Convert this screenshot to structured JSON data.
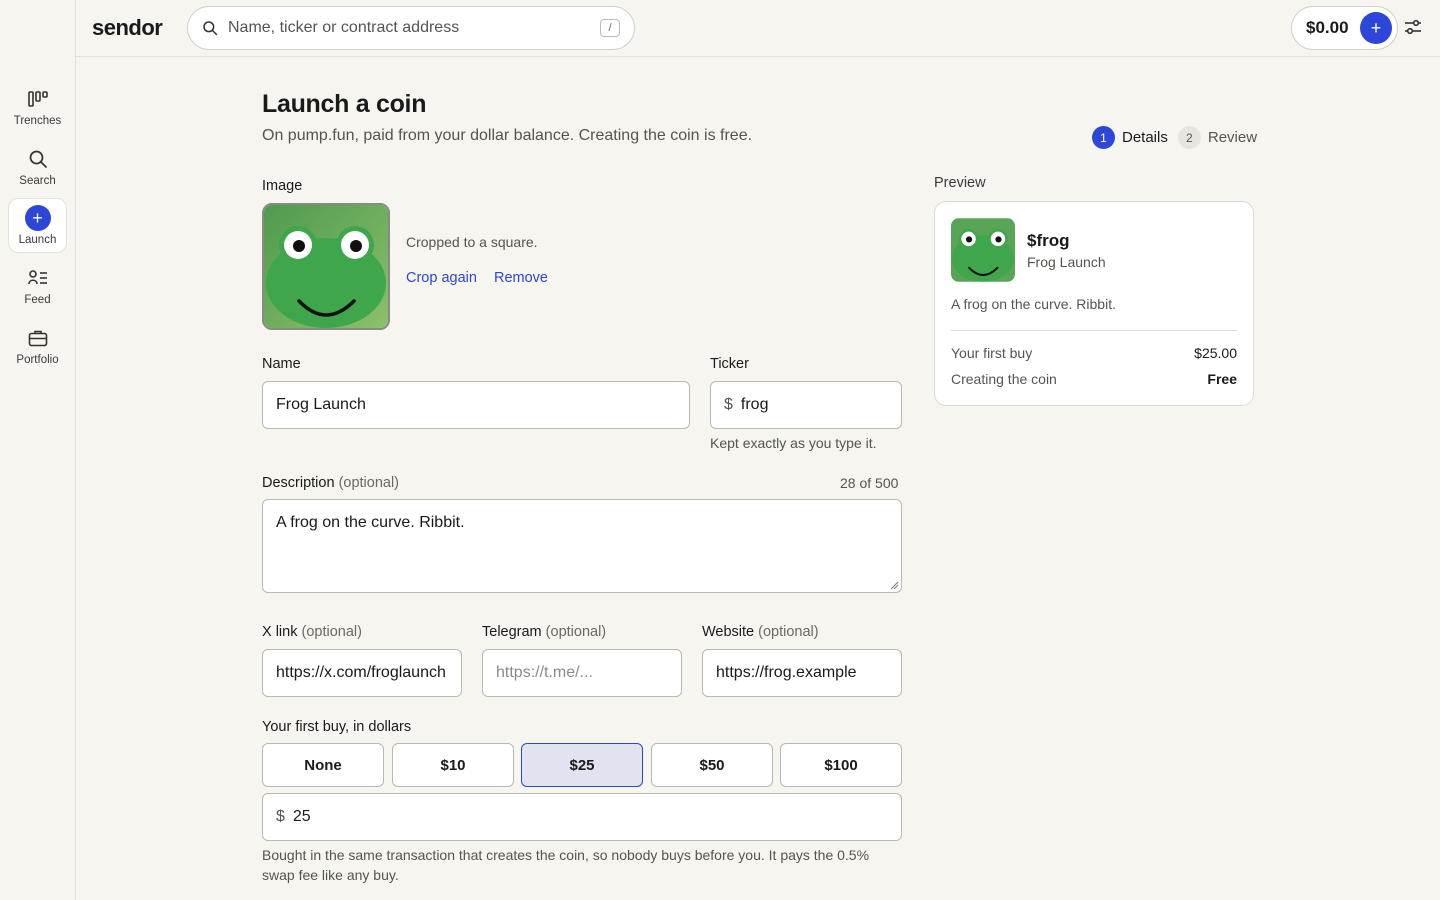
{
  "app": {
    "logo": "sendor"
  },
  "search": {
    "placeholder": "Name, ticker or contract address",
    "shortcut": "/"
  },
  "header": {
    "balance": "$0.00",
    "add_label": "+"
  },
  "sidebar": {
    "items": [
      {
        "label": "Trenches",
        "icon": "trenches-icon"
      },
      {
        "label": "Search",
        "icon": "search-icon"
      },
      {
        "label": "Launch",
        "icon": "plus-icon"
      },
      {
        "label": "Feed",
        "icon": "feed-icon"
      },
      {
        "label": "Portfolio",
        "icon": "briefcase-icon"
      }
    ],
    "active": "Launch"
  },
  "page": {
    "title": "Launch a coin",
    "subtitle": "On pump.fun, paid from your dollar balance. Creating the coin is free.",
    "steps": [
      {
        "num": "1",
        "label": "Details"
      },
      {
        "num": "2",
        "label": "Review"
      }
    ]
  },
  "form": {
    "image_label": "Image",
    "crop_note": "Cropped to a square.",
    "crop_again": "Crop again",
    "remove": "Remove",
    "name_label": "Name",
    "name_value": "Frog Launch",
    "ticker_label": "Ticker",
    "ticker_prefix": "$",
    "ticker_value": "frog",
    "ticker_hint": "Kept exactly as you type it.",
    "description_label": "Description",
    "optional": "(optional)",
    "description_value": "A frog on the curve. Ribbit.",
    "description_count": "28 of 500",
    "x_label": "X link",
    "x_value": "https://x.com/froglaunch",
    "telegram_label": "Telegram",
    "telegram_placeholder": "https://t.me/...",
    "website_label": "Website",
    "website_value": "https://frog.example",
    "first_buy_label": "Your first buy, in dollars",
    "amounts": [
      "None",
      "$10",
      "$25",
      "$50",
      "$100"
    ],
    "selected_amount": "$25",
    "amount_prefix": "$",
    "amount_value": "25",
    "first_buy_note": "Bought in the same transaction that creates the coin, so nobody buys before you. It pays the 0.5%",
    "first_buy_note_2": "swap fee like any buy."
  },
  "preview": {
    "label": "Preview",
    "symbol": "$frog",
    "name": "Frog Launch",
    "description": "A frog on the curve. Ribbit.",
    "rows": [
      {
        "key": "Your first buy",
        "value": "$25.00"
      },
      {
        "key": "Creating the coin",
        "value": "Free"
      }
    ]
  },
  "colors": {
    "accent": "#2c46d8",
    "background": "#f6f5ef",
    "frog_green": "#3fa64c"
  }
}
